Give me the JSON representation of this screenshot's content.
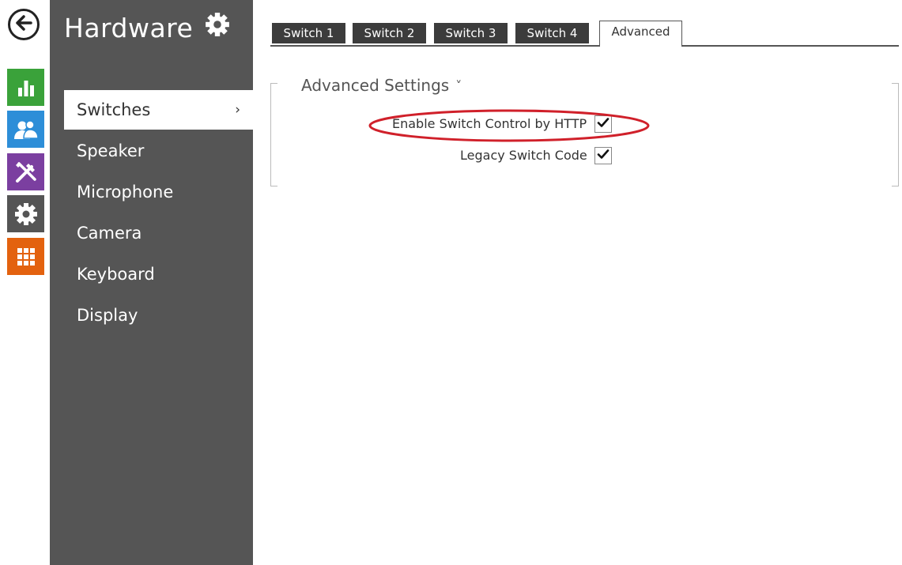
{
  "rail": {
    "back_icon": "arrow-left-icon",
    "buttons": [
      {
        "icon": "bar-chart-icon",
        "color": "#3aa23a"
      },
      {
        "icon": "users-icon",
        "color": "#2d8ed8"
      },
      {
        "icon": "tools-icon",
        "color": "#7b3fa0"
      },
      {
        "icon": "gear-icon",
        "color": "#555555"
      },
      {
        "icon": "grid-icon",
        "color": "#e3620f"
      }
    ]
  },
  "sidebar": {
    "title": "Hardware",
    "title_icon": "gear-icon",
    "active_chevron": "›",
    "items": [
      {
        "label": "Switches",
        "active": true
      },
      {
        "label": "Speaker",
        "active": false
      },
      {
        "label": "Microphone",
        "active": false
      },
      {
        "label": "Camera",
        "active": false
      },
      {
        "label": "Keyboard",
        "active": false
      },
      {
        "label": "Display",
        "active": false
      }
    ]
  },
  "tabs": [
    {
      "label": "Switch 1",
      "active": false
    },
    {
      "label": "Switch 2",
      "active": false
    },
    {
      "label": "Switch 3",
      "active": false
    },
    {
      "label": "Switch 4",
      "active": false
    },
    {
      "label": "Advanced",
      "active": true
    }
  ],
  "section": {
    "title": "Advanced Settings",
    "toggle_glyph": "˅"
  },
  "fields": [
    {
      "label": "Enable Switch Control by HTTP",
      "checked": true,
      "highlighted": true
    },
    {
      "label": "Legacy Switch Code",
      "checked": true,
      "highlighted": false
    }
  ],
  "colors": {
    "sidebar_bg": "#555555",
    "tab_bg": "#3c3c3c",
    "highlight": "#d0202a"
  }
}
